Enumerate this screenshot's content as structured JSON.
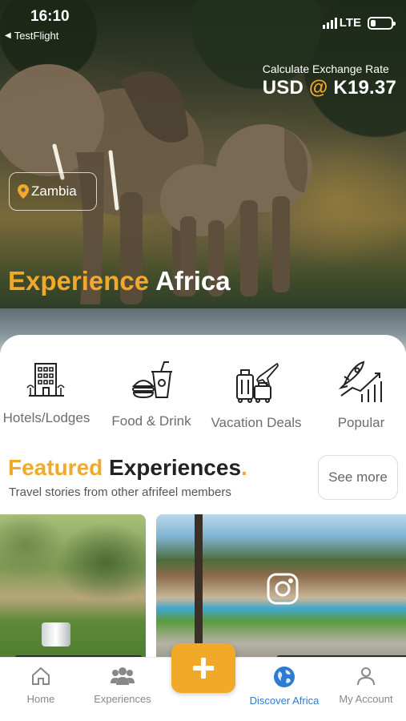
{
  "status_bar": {
    "time": "16:10",
    "back_app": "TestFlight",
    "network": "LTE"
  },
  "exchange": {
    "label": "Calculate Exchange Rate",
    "currency": "USD",
    "at": "@",
    "value": "K19.37"
  },
  "location": {
    "name": "Zambia",
    "icon": "map-pin-icon"
  },
  "hero": {
    "title_highlight": "Experience",
    "title_rest": "Africa"
  },
  "categories": [
    {
      "label": "Hotels/Lodges",
      "icon": "hotel-icon"
    },
    {
      "label": "Food & Drink",
      "icon": "food-drink-icon"
    },
    {
      "label": "Vacation Deals",
      "icon": "luggage-plane-icon"
    },
    {
      "label": "Popular",
      "icon": "rocket-chart-icon"
    }
  ],
  "featured": {
    "title_highlight": "Featured",
    "title_rest": "Experiences",
    "title_dot": ".",
    "subtitle": "Travel stories from other afrifeel members",
    "see_more": "See more"
  },
  "tabs": [
    {
      "label": "Home",
      "icon": "home-icon",
      "active": false
    },
    {
      "label": "Experiences",
      "icon": "people-icon",
      "active": false
    },
    {
      "label": "Discover Africa",
      "icon": "globe-icon",
      "active": true
    },
    {
      "label": "My Account",
      "icon": "user-icon",
      "active": false
    }
  ],
  "fab_icon": "plus-icon",
  "colors": {
    "accent": "#f0a928",
    "active_tab": "#2e7bd1",
    "text_dark": "#222222",
    "text_muted": "#6d6d6d"
  }
}
